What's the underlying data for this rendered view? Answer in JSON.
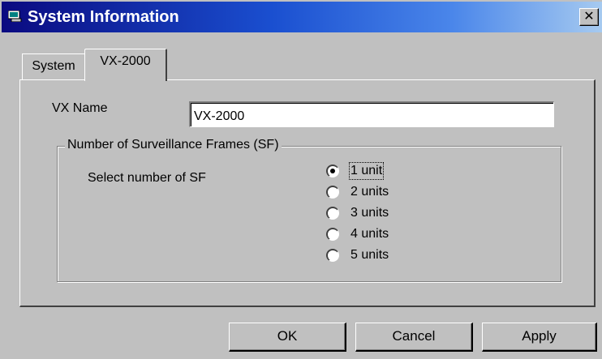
{
  "window": {
    "title": "System Information",
    "close_label": "✕",
    "icon": "system-window-icon"
  },
  "tabs": [
    {
      "label": "System",
      "active": false
    },
    {
      "label": "VX-2000",
      "active": true
    }
  ],
  "form": {
    "vx_name_label": "VX Name",
    "vx_name_value": "VX-2000"
  },
  "group": {
    "legend": "Number of Surveillance Frames (SF)",
    "select_label": "Select number of SF",
    "options": [
      {
        "label": "1 unit",
        "checked": true
      },
      {
        "label": "2 units",
        "checked": false
      },
      {
        "label": "3 units",
        "checked": false
      },
      {
        "label": "4 units",
        "checked": false
      },
      {
        "label": "5 units",
        "checked": false
      }
    ]
  },
  "buttons": {
    "ok": "OK",
    "cancel": "Cancel",
    "apply": "Apply"
  },
  "colors": {
    "face": "#c0c0c0",
    "title_start": "#0a0a80",
    "title_end": "#a6caf0"
  }
}
